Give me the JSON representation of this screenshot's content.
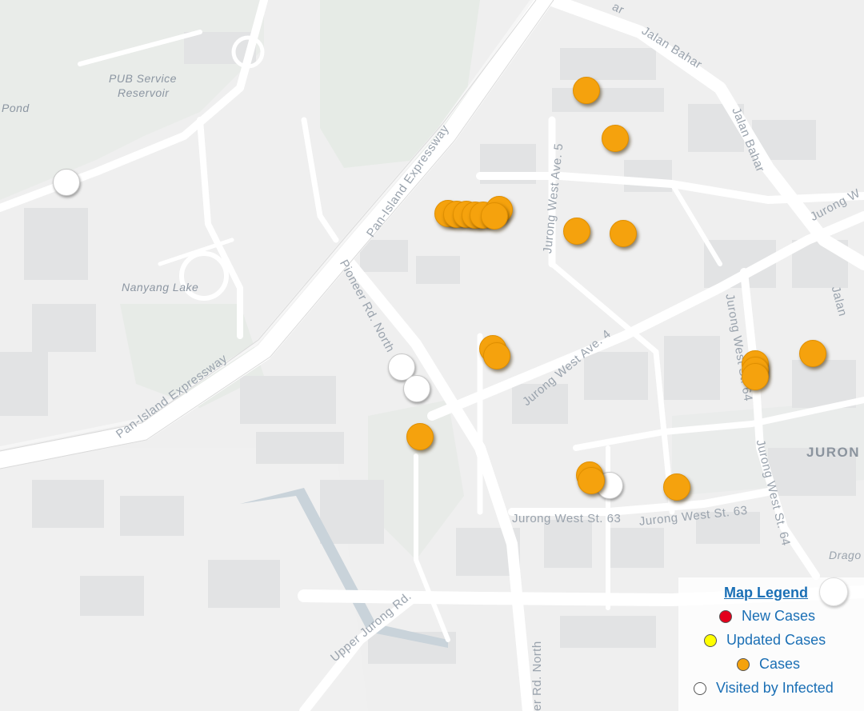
{
  "map": {
    "labels": {
      "pond": "Pond",
      "pub_reservoir_1": "PUB Service",
      "pub_reservoir_2": "Reservoir",
      "nanyang_lake": "Nanyang Lake",
      "pie_upper": "Pan-Island Expressway",
      "pie_lower": "Pan-Island Expressway",
      "jalan_bahar_1": "Jalan Bahar",
      "jalan_bahar_2": "Jalan Bahar",
      "jalan_bahar_top": "ar",
      "jurong_w_right": "Jurong W",
      "jalan_right": "Jalan",
      "jw_ave5": "Jurong West Ave. 5",
      "pioneer_north": "Pioneer Rd. North",
      "jw_ave4": "Jurong West Ave. 4",
      "jw_st64_a": "Jurong West St. 64",
      "jw_st64_b": "Jurong West St. 64",
      "jw_st63_a": "Jurong West St. 63",
      "jw_st63_b": "Jurong West St. 63",
      "upper_jurong": "Upper Jurong Rd.",
      "er_rd_north": "er Rd. North",
      "jurong_district": "JURON",
      "drago": "Drago"
    }
  },
  "markers": {
    "cases_count": 21,
    "visited_count": 4
  },
  "legend": {
    "title": "Map Legend",
    "items": [
      {
        "label": "New Cases",
        "color": "#e3001b"
      },
      {
        "label": "Updated Cases",
        "color": "#ffff00"
      },
      {
        "label": "Cases",
        "color": "#f5a20d"
      },
      {
        "label": "Visited by Infected",
        "color": "#ffffff"
      }
    ]
  },
  "colors": {
    "case_marker": "#f5a20d",
    "visited_marker": "#ffffff",
    "legend_text": "#1a6fb5",
    "background": "#efefef"
  }
}
